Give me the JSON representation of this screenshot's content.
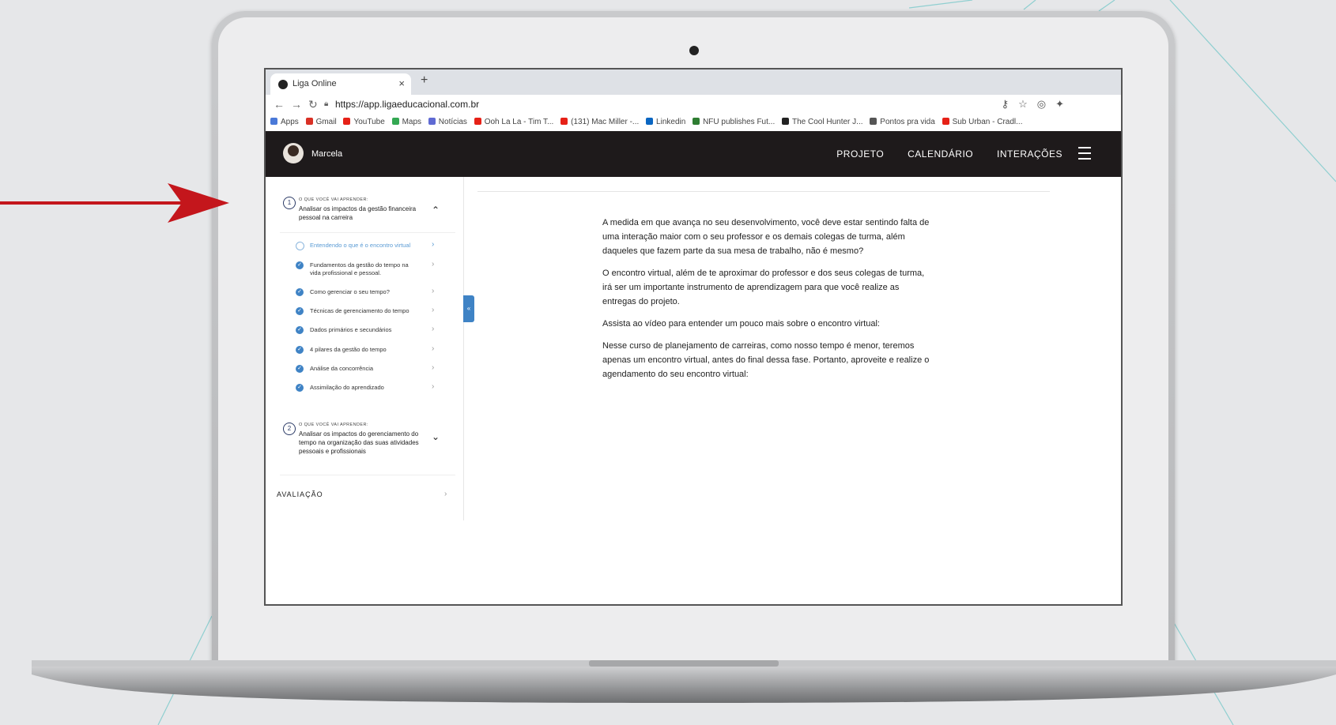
{
  "browser": {
    "tab_title": "Liga Online",
    "new_tab": "+",
    "close_tab": "×",
    "url": "https://app.ligaeducacional.com.br",
    "bookmarks": [
      {
        "label": "Apps",
        "color": "#4a79d8"
      },
      {
        "label": "Gmail",
        "color": "#d93025"
      },
      {
        "label": "YouTube",
        "color": "#e62117"
      },
      {
        "label": "Maps",
        "color": "#34a853"
      },
      {
        "label": "Notícias",
        "color": "#5f6ad3"
      },
      {
        "label": "Ooh La La - Tim T...",
        "color": "#e62117"
      },
      {
        "label": "(131) Mac Miller -...",
        "color": "#e62117"
      },
      {
        "label": "Linkedin",
        "color": "#0a66c2"
      },
      {
        "label": "NFU publishes Fut...",
        "color": "#2e7d32"
      },
      {
        "label": "The Cool Hunter J...",
        "color": "#222222"
      },
      {
        "label": "Pontos pra vida",
        "color": "#555555"
      },
      {
        "label": "Sub Urban - Cradl...",
        "color": "#e62117"
      }
    ]
  },
  "app": {
    "user_name": "Marcela",
    "nav": [
      "PROJETO",
      "CALENDÁRIO",
      "INTERAÇÕES"
    ]
  },
  "sidebar": {
    "section1": {
      "number": "1",
      "kicker": "O QUE VOCÊ VAI APRENDER:",
      "title": "Analisar os impactos da gestão financeira pessoal na carreira",
      "lessons": [
        {
          "label": "Entendendo o que é o encontro virtual",
          "status": "current"
        },
        {
          "label": "Fundamentos da gestão do tempo na vida profissional e pessoal.",
          "status": "done"
        },
        {
          "label": "Como gerenciar o seu tempo?",
          "status": "done"
        },
        {
          "label": "Técnicas de gerenciamento do tempo",
          "status": "done"
        },
        {
          "label": "Dados primários e secundários",
          "status": "done"
        },
        {
          "label": "4 pilares da gestão do tempo",
          "status": "done"
        },
        {
          "label": "Análise da concorrência",
          "status": "done"
        },
        {
          "label": "Assimilação do aprendizado",
          "status": "done"
        }
      ]
    },
    "section2": {
      "number": "2",
      "kicker": "O QUE VOCÊ VAI APRENDER:",
      "title": "Analisar os impactos do gerenciamento do tempo na organização das suas atividades pessoais e profissionais"
    },
    "evaluation": "AVALIAÇÃO"
  },
  "content": {
    "paragraphs": [
      "A medida em que avança no seu desenvolvimento, você deve estar sentindo falta de uma interação maior com o seu professor e os demais colegas de turma, além daqueles que fazem parte da sua mesa de trabalho, não é mesmo?",
      "O encontro virtual, além de te aproximar do professor e dos seus colegas de turma, irá ser um importante instrumento de aprendizagem para que você realize as entregas do projeto.",
      "Assista ao vídeo para entender um pouco mais sobre o encontro virtual:",
      "Nesse curso de planejamento de carreiras, como nosso tempo é menor, teremos apenas um encontro virtual, antes do final dessa fase. Portanto, aproveite e realize o agendamento do seu encontro virtual:"
    ]
  },
  "colors": {
    "accent": "#3f83c5",
    "header_bg": "#1e1a1b",
    "arrow": "#c4161c"
  }
}
